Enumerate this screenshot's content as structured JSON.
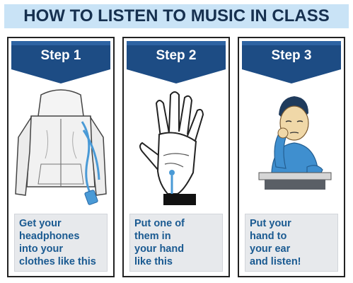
{
  "title": "HOW TO LISTEN TO MUSIC IN CLASS",
  "colors": {
    "title_bg": "#c9e3f6",
    "title_text": "#16304f",
    "banner": "#1d4c84",
    "caption_bg": "#e7e9ec",
    "caption_text": "#1a5a91",
    "accent_blue": "#4a9ad6"
  },
  "steps": [
    {
      "label": "Step 1",
      "caption_lines": [
        "Get your",
        "headphones",
        "into your",
        "clothes like this"
      ],
      "image_tag": "iPod",
      "icon": "hoodie-with-headphones-icon"
    },
    {
      "label": "Step 2",
      "caption_lines": [
        "Put one of",
        "them in",
        "your hand",
        "like this"
      ],
      "icon": "hand-with-earbud-icon"
    },
    {
      "label": "Step 3",
      "caption_lines": [
        "Put your",
        "hand to",
        "your ear",
        "and listen!"
      ],
      "icon": "student-at-desk-icon"
    }
  ]
}
